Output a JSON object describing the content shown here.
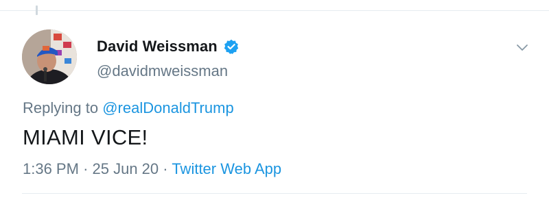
{
  "tweet": {
    "author": {
      "display_name": "David Weissman",
      "handle": "@davidmweissman",
      "verified": true
    },
    "reply": {
      "prefix": "Replying to",
      "mention": "@realDonaldTrump"
    },
    "text": "MIAMI VICE!",
    "meta": {
      "time": "1:36 PM",
      "separator_1": "·",
      "date": "25 Jun 20",
      "separator_2": "·",
      "source": "Twitter Web App"
    }
  },
  "icons": {
    "verified": "verified-badge-icon",
    "menu": "chevron-down-icon"
  },
  "colors": {
    "link": "#1b95e0",
    "secondary_text": "#657786",
    "primary_text": "#14171a",
    "divider": "#e6ecf0"
  }
}
